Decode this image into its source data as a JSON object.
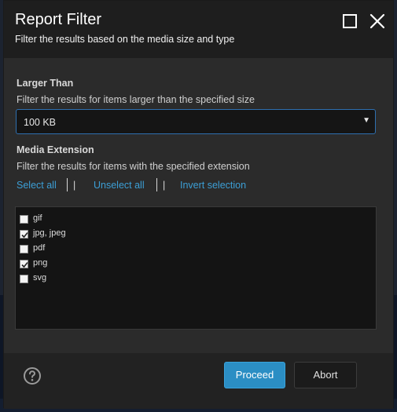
{
  "dialog": {
    "title": "Report Filter",
    "subtitle": "Filter the results based on the media size and type"
  },
  "size_filter": {
    "heading": "Larger Than",
    "description": "Filter the results for items larger than the specified size",
    "selected": "100 KB"
  },
  "extension_filter": {
    "heading": "Media Extension",
    "description": "Filter the results for items with the specified extension",
    "select_all": "Select all",
    "unselect_all": "Unselect all",
    "invert_selection": "Invert selection",
    "separator": "|",
    "options": [
      {
        "label": "gif",
        "checked": false
      },
      {
        "label": "jpg, jpeg",
        "checked": true
      },
      {
        "label": "pdf",
        "checked": false
      },
      {
        "label": "png",
        "checked": true
      },
      {
        "label": "svg",
        "checked": false
      }
    ]
  },
  "footer": {
    "proceed": "Proceed",
    "abort": "Abort"
  },
  "colors": {
    "accent": "#2b8ec4",
    "link": "#3c9fd6",
    "dialog_bg": "#2a2a2a",
    "header_bg": "#1e1e1e"
  },
  "icons": {
    "maximize": "maximize-icon",
    "close": "close-icon",
    "help": "help-icon",
    "dropdown": "dropdown-arrow-icon",
    "checkmark": "checkmark-icon"
  }
}
